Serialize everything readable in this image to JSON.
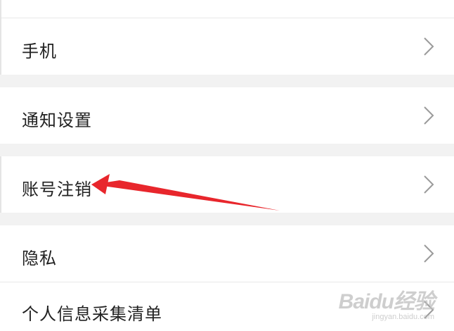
{
  "settings": {
    "items": [
      {
        "label": "手机",
        "chevron_icon": "chevron-right-icon"
      },
      {
        "label": "通知设置",
        "chevron_icon": "chevron-right-icon"
      },
      {
        "label": "账号注销",
        "chevron_icon": "chevron-right-icon"
      },
      {
        "label": "隐私",
        "chevron_icon": "chevron-right-icon"
      },
      {
        "label": "个人信息采集清单",
        "chevron_icon": "chevron-right-icon"
      }
    ]
  },
  "annotation": {
    "type": "red-arrow-pointing-left",
    "color": "#e8262c",
    "target": "账号注销"
  },
  "watermark": {
    "brand": "Baidu经验",
    "url": "jingyan.baidu.com"
  },
  "colors": {
    "background": "#f2f2f2",
    "row_background": "#ffffff",
    "text": "#222222",
    "chevron": "#9a9a9a"
  }
}
